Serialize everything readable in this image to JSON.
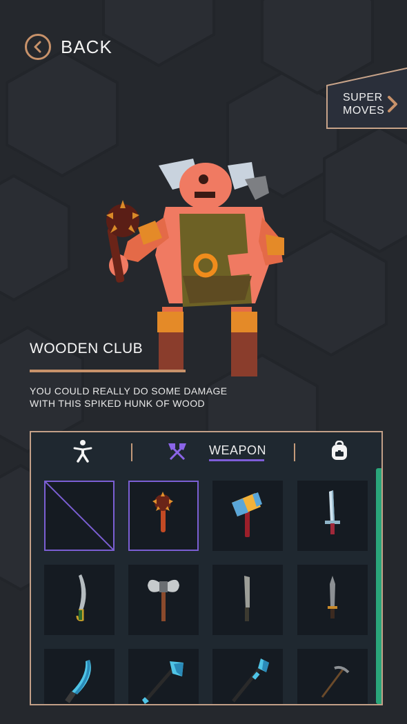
{
  "nav": {
    "back_label": "BACK"
  },
  "super_moves": {
    "label_line1": "SUPER",
    "label_line2": "MOVES"
  },
  "item": {
    "title": "WOODEN CLUB",
    "description_line1": "YOU COULD REALLY DO SOME DAMAGE",
    "description_line2": "WITH THIS SPIKED HUNK OF WOOD"
  },
  "inventory": {
    "tabs": [
      {
        "name": "character",
        "icon": "person-icon"
      },
      {
        "name": "weapon",
        "icon": "crossed-axes-icon",
        "label": "WEAPON",
        "active": true
      },
      {
        "name": "backpack",
        "icon": "backpack-icon"
      }
    ],
    "slots": [
      {
        "item": "none",
        "selected": true
      },
      {
        "item": "spiked-club",
        "selected": true
      },
      {
        "item": "war-hammer"
      },
      {
        "item": "short-sword"
      },
      {
        "item": "scimitar"
      },
      {
        "item": "double-axe"
      },
      {
        "item": "machete"
      },
      {
        "item": "dagger"
      },
      {
        "item": "crystal-blade"
      },
      {
        "item": "crystal-axe"
      },
      {
        "item": "crystal-mace"
      },
      {
        "item": "pickaxe"
      }
    ]
  },
  "colors": {
    "accent": "#c8926a",
    "selection": "#7b5fd4",
    "scrollbar": "#2aa67a",
    "background": "#25282d"
  }
}
